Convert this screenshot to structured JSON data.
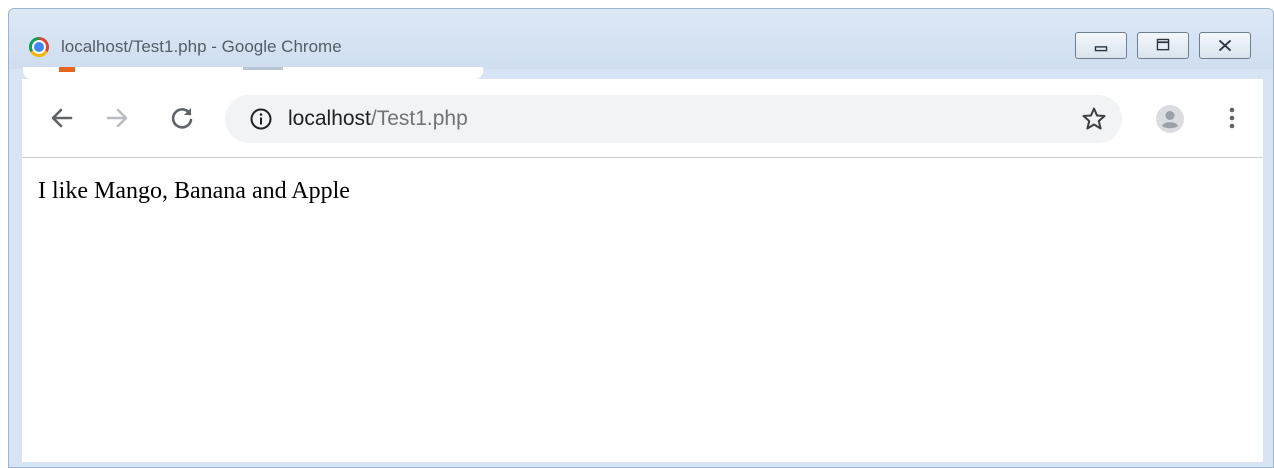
{
  "window": {
    "title": "localhost/Test1.php - Google Chrome",
    "controls": {
      "minimize": "minimize-icon",
      "maximize": "maximize-icon",
      "close": "close-icon"
    }
  },
  "toolbar": {
    "back_icon": "arrow-left-icon",
    "forward_icon": "arrow-right-icon",
    "reload_icon": "reload-icon",
    "address": {
      "info_icon": "info-icon",
      "host": "localhost",
      "path": "/Test1.php"
    },
    "bookmark_icon": "star-icon",
    "profile_icon": "avatar-icon",
    "menu_icon": "vertical-dots-icon"
  },
  "page": {
    "text": "I like Mango, Banana and Apple"
  },
  "colors": {
    "window_frame": "#d6e4f3",
    "omnibox_bg": "#f1f3f4",
    "url_host": "#202124",
    "url_path": "#6f7478"
  }
}
